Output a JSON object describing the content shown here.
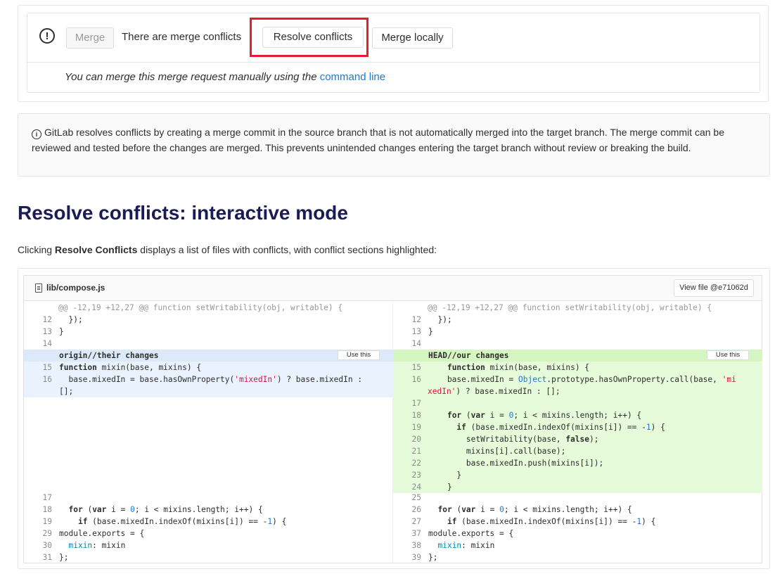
{
  "merge_widget": {
    "merge_label": "Merge",
    "conflict_text": "There are merge conflicts",
    "resolve_label": "Resolve conflicts",
    "merge_locally_label": "Merge locally",
    "manual_text": "You can merge this merge request manually using the ",
    "manual_link": "command line",
    "highlight_color": "#e41e2b"
  },
  "info_note": {
    "text": "GitLab resolves conflicts by creating a merge commit in the source branch that is not automatically merged into the target branch. The merge commit can be reviewed and tested before the changes are merged. This prevents unintended changes entering the target branch without review or breaking the build."
  },
  "section": {
    "heading": "Resolve conflicts: interactive mode",
    "desc_prefix": "Clicking ",
    "desc_bold": "Resolve Conflicts",
    "desc_suffix": " displays a list of files with conflicts, with conflict sections highlighted:"
  },
  "diff": {
    "file_name": "lib/compose.js",
    "view_file_label": "View file @e71062d",
    "use_this_label": "Use this",
    "hunk_header": "@@ -12,19 +12,27 @@ function setWritability(obj, writable) {",
    "left_header": "origin//their changes",
    "right_header": "HEAD//our changes",
    "left_lines": [
      {
        "ln": "12",
        "code": "  });"
      },
      {
        "ln": "13",
        "code": "}"
      },
      {
        "ln": "14",
        "code": ""
      },
      {
        "ln": "15",
        "code": "function mixin(base, mixins) {"
      },
      {
        "ln": "16",
        "code": "  base.mixedIn = base.hasOwnProperty('mixedIn') ? base.mixedIn :"
      },
      {
        "ln": "",
        "code": "[];"
      },
      {
        "ln": "17",
        "code": ""
      },
      {
        "ln": "18",
        "code": "  for (var i = 0; i < mixins.length; i++) {"
      },
      {
        "ln": "19",
        "code": "    if (base.mixedIn.indexOf(mixins[i]) == -1) {"
      },
      {
        "ln": "29",
        "code": "module.exports = {"
      },
      {
        "ln": "30",
        "code": "  mixin: mixin"
      },
      {
        "ln": "31",
        "code": "};"
      }
    ],
    "right_lines": [
      {
        "ln": "12",
        "code": "  });"
      },
      {
        "ln": "13",
        "code": "}"
      },
      {
        "ln": "14",
        "code": ""
      },
      {
        "ln": "15",
        "code": "    function mixin(base, mixins) {"
      },
      {
        "ln": "16",
        "code": "    base.mixedIn = Object.prototype.hasOwnProperty.call(base, 'mi"
      },
      {
        "ln": "",
        "code": "xedIn') ? base.mixedIn : [];"
      },
      {
        "ln": "17",
        "code": ""
      },
      {
        "ln": "18",
        "code": "    for (var i = 0; i < mixins.length; i++) {"
      },
      {
        "ln": "19",
        "code": "      if (base.mixedIn.indexOf(mixins[i]) == -1) {"
      },
      {
        "ln": "20",
        "code": "        setWritability(base, false);"
      },
      {
        "ln": "21",
        "code": "        mixins[i].call(base);"
      },
      {
        "ln": "22",
        "code": "        base.mixedIn.push(mixins[i]);"
      },
      {
        "ln": "23",
        "code": "      }"
      },
      {
        "ln": "24",
        "code": "    }"
      },
      {
        "ln": "25",
        "code": ""
      },
      {
        "ln": "26",
        "code": "  for (var i = 0; i < mixins.length; i++) {"
      },
      {
        "ln": "27",
        "code": "    if (base.mixedIn.indexOf(mixins[i]) == -1) {"
      },
      {
        "ln": "37",
        "code": "module.exports = {"
      },
      {
        "ln": "38",
        "code": "  mixin: mixin"
      },
      {
        "ln": "39",
        "code": "};"
      }
    ]
  }
}
